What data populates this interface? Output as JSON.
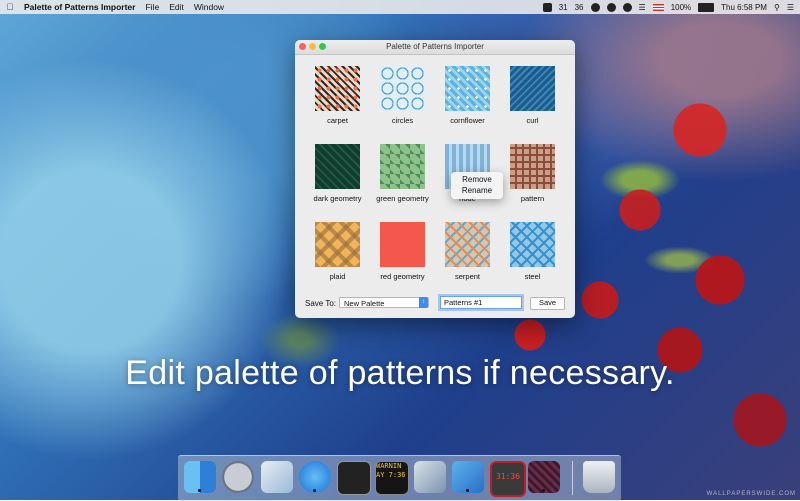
{
  "menubar": {
    "app_name": "Palette of Patterns Importer",
    "menus": [
      "File",
      "Edit",
      "Window"
    ],
    "status": {
      "num1": "31",
      "num2": "36",
      "battery": "100%",
      "clock": "Thu 6:58 PM"
    }
  },
  "window": {
    "title": "Palette of Patterns Importer",
    "patterns": [
      "carpet",
      "circles",
      "cornflower",
      "curl",
      "dark geometry",
      "green geometry",
      "node",
      "pattern",
      "plaid",
      "red geometry",
      "serpent",
      "steel"
    ],
    "context_menu": [
      "Remove",
      "Rename"
    ],
    "save_to_label": "Save To:",
    "save_to_value": "New Palette",
    "name_value": "Patterns #1",
    "save_button": "Save"
  },
  "caption": "Edit palette of patterns if necessary.",
  "dock": {
    "console_text": "WARNIN AY 7:36",
    "clock_text": "31:36"
  },
  "watermark": "WALLPAPERSWIDE.COM"
}
